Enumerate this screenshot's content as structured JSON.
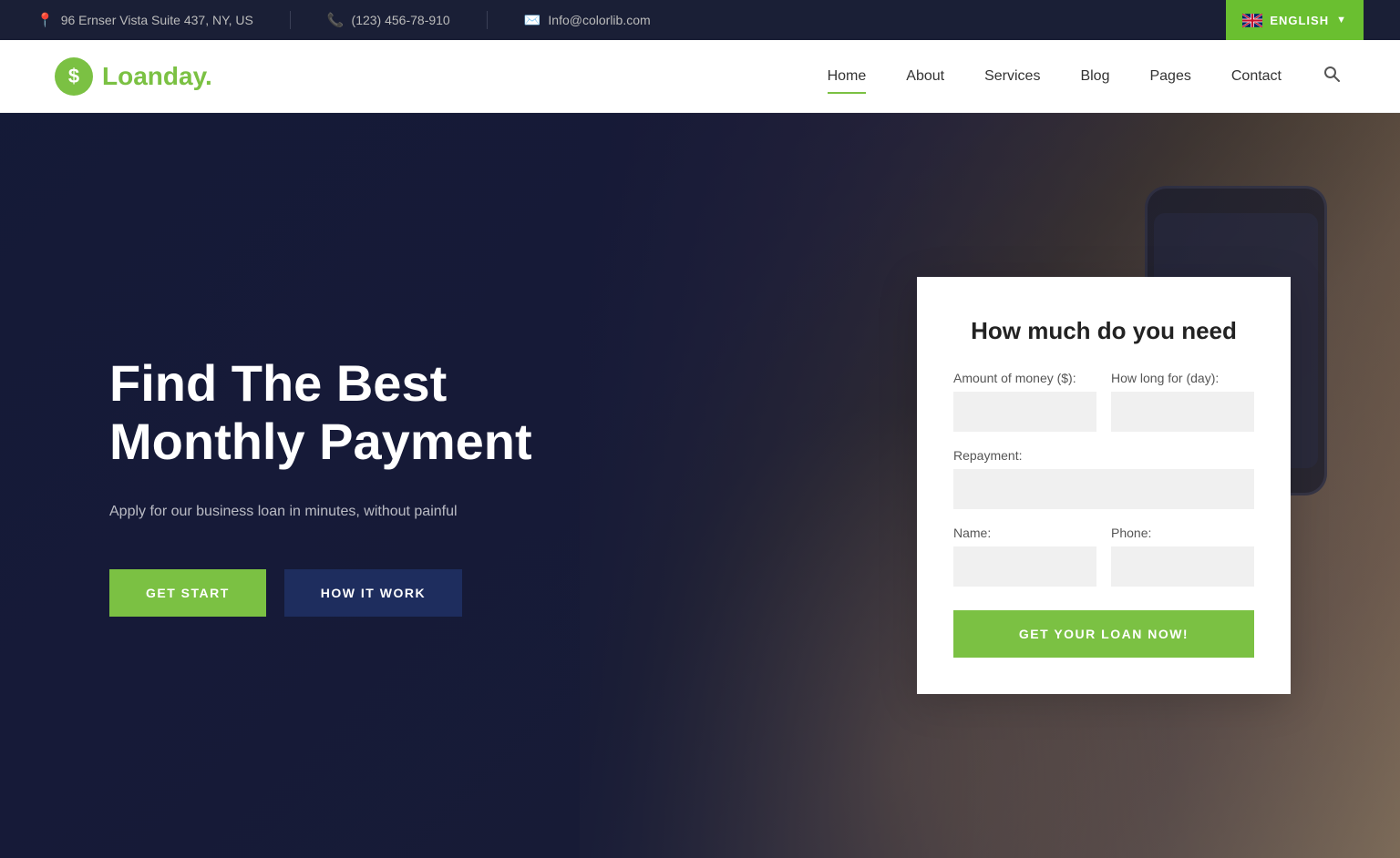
{
  "topbar": {
    "address": "96 Ernser Vista Suite 437, NY, US",
    "phone": "(123) 456-78-910",
    "email": "Info@colorlib.com",
    "language": "ENGLISH"
  },
  "navbar": {
    "logo_text_black": "Loan",
    "logo_text_green": "day.",
    "nav_items": [
      {
        "label": "Home",
        "active": true
      },
      {
        "label": "About",
        "active": false
      },
      {
        "label": "Services",
        "active": false
      },
      {
        "label": "Blog",
        "active": false
      },
      {
        "label": "Pages",
        "active": false
      },
      {
        "label": "Contact",
        "active": false
      }
    ]
  },
  "hero": {
    "title": "Find The Best Monthly Payment",
    "subtitle": "Apply for our business loan in minutes, without painful",
    "btn_get_start": "GET START",
    "btn_how_it_work": "HOW IT WORK"
  },
  "form": {
    "heading": "How much do you need",
    "amount_label": "Amount of money ($):",
    "duration_label": "How long for (day):",
    "repayment_label": "Repayment:",
    "name_label": "Name:",
    "phone_label": "Phone:",
    "submit_label": "GET YOUR LOAN NOW!"
  }
}
